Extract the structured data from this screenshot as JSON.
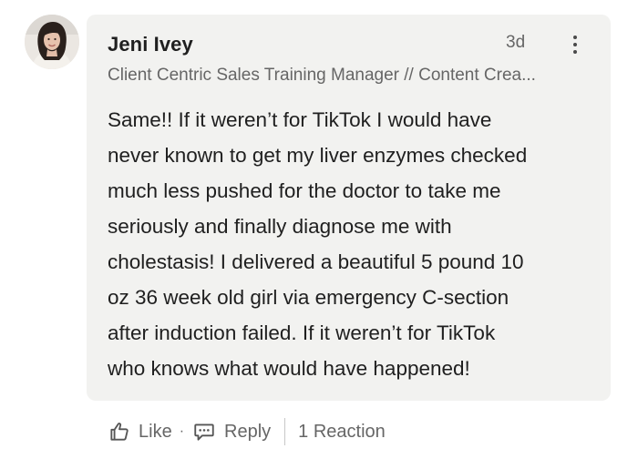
{
  "comment": {
    "author_name": "Jeni Ivey",
    "author_headline": "Client Centric Sales Training Manager // Content Crea...",
    "timestamp": "3d",
    "lines": [
      "Same!! If it weren’t for TikTok I would have",
      "never known to get my liver enzymes checked",
      "much less pushed for the doctor to take me",
      "seriously and finally diagnose me with",
      "cholestasis! I delivered a beautiful 5 pound 10",
      "oz 36 week old girl via emergency C-section",
      "after induction failed. If it weren’t for TikTok",
      "who knows what would have happened!"
    ]
  },
  "actions": {
    "like_label": "Like",
    "separator": "·",
    "reply_label": "Reply",
    "reactions_label": "1 Reaction"
  },
  "icons": {
    "like": "thumbs-up-icon",
    "reply": "speech-bubble-icon",
    "more": "more-vertical-icon"
  },
  "colors": {
    "card_background": "#f2f2f0",
    "primary_text": "#1f1f1f",
    "secondary_text": "#666666"
  }
}
